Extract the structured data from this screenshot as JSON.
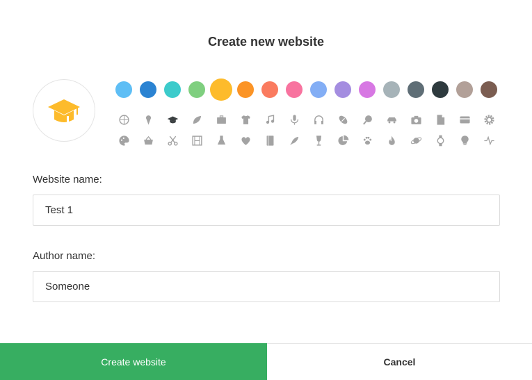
{
  "dialog": {
    "title": "Create new website",
    "selected_color": "#fdbb2b",
    "selected_icon": "graduation-cap-icon"
  },
  "colors": [
    "#5ebef5",
    "#2b83d2",
    "#3ccbcb",
    "#7fcf7f",
    "#fdbb2b",
    "#fb9426",
    "#fa7b5f",
    "#f8739f",
    "#83aef5",
    "#a48de0",
    "#d778e3",
    "#a6b3b8",
    "#5f6e76",
    "#2e3a3e",
    "#b2a098",
    "#7b5d51"
  ],
  "icons": [
    [
      "basketball-icon",
      "ice-cream-icon",
      "graduation-cap-icon",
      "leaf-icon",
      "briefcase-icon",
      "tshirt-icon",
      "music-note-icon",
      "microphone-icon",
      "headphones-icon",
      "football-icon",
      "ping-pong-icon",
      "car-icon",
      "camera-icon",
      "document-icon",
      "credit-card-icon",
      "gear-icon"
    ],
    [
      "palette-icon",
      "shopping-basket-icon",
      "scissors-icon",
      "film-icon",
      "flask-icon",
      "heart-icon",
      "book-icon",
      "rocket-icon",
      "wine-glass-icon",
      "pie-chart-icon",
      "paw-icon",
      "flame-icon",
      "planet-icon",
      "watch-icon",
      "lightbulb-icon",
      "pulse-icon"
    ]
  ],
  "form": {
    "website_name_label": "Website name:",
    "website_name_value": "Test 1",
    "author_name_label": "Author name:",
    "author_name_value": "Someone"
  },
  "actions": {
    "create_label": "Create website",
    "cancel_label": "Cancel"
  }
}
